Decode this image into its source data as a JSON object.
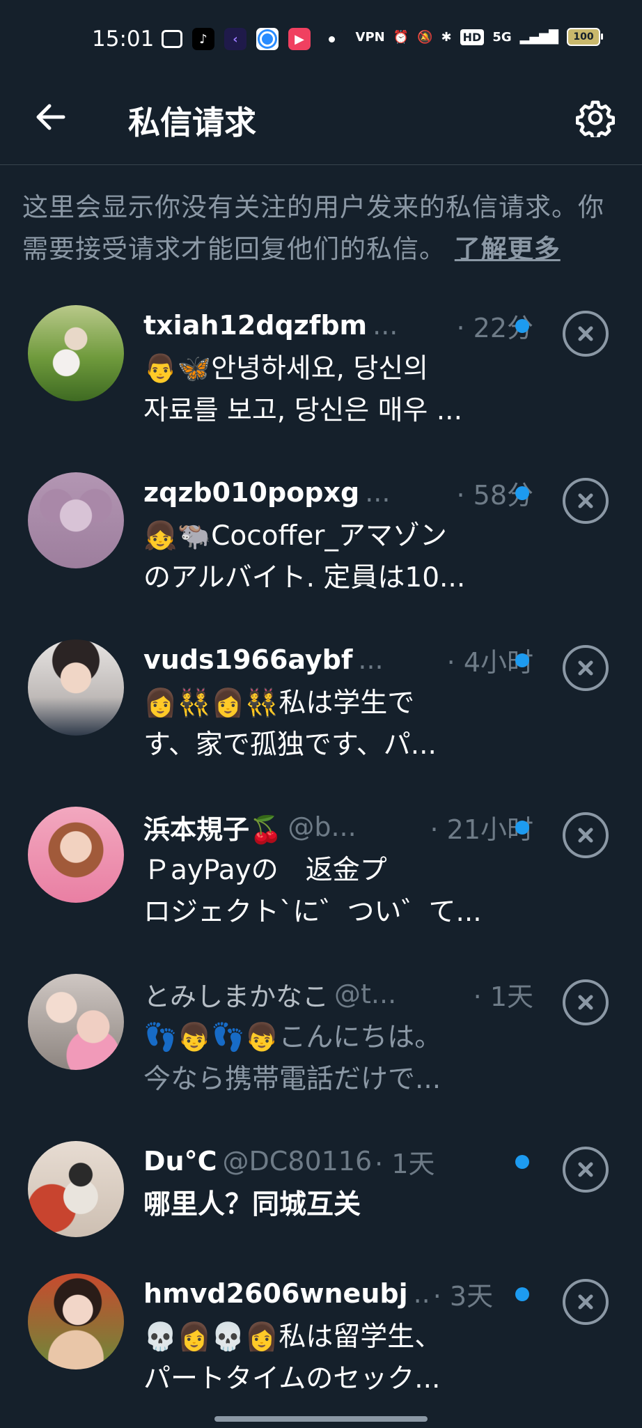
{
  "status_bar": {
    "time": "15:01",
    "network": "5G",
    "battery": "100",
    "vpn_label": "VPN",
    "hd_label": "HD"
  },
  "header": {
    "title": "私信请求",
    "back_icon": "arrow-left-icon",
    "settings_icon": "gear-icon"
  },
  "intro": {
    "text": "这里会显示你没有关注的用户发来的私信请求。你需要接受请求才能回复他们的私信。",
    "link": "了解更多"
  },
  "requests": [
    {
      "name": "txiah12dqzfbm",
      "handle": "...",
      "time": "· 22分",
      "unread": true,
      "line1": "👨🦋안녕하세요, 당신의",
      "line2": "자료를 보고, 당신은 매우 ...",
      "read": false
    },
    {
      "name": "zqzb010popxg",
      "handle": "...",
      "time": "· 58分",
      "unread": true,
      "line1": "👧🐃Cocoffer_アマゾン",
      "line2": "のアルバイト. 定員は10...",
      "read": false
    },
    {
      "name": "vuds1966aybf",
      "handle": "...",
      "time": "· 4小时",
      "unread": true,
      "line1": "👩👯👩👯私は学生で",
      "line2": "す、家で孤独です、パ...",
      "read": false
    },
    {
      "name": "浜本規子🍒",
      "handle": "@b...",
      "time": "· 21小时",
      "unread": true,
      "line1": "ＰayPayの　返金プ",
      "line2": "ロジェクト`に゛つい゛て...",
      "read": false
    },
    {
      "name": "とみしまかなこ",
      "handle": "@t...",
      "time": "· 1天",
      "unread": false,
      "line1": "👣👦👣👦こんにちは。",
      "line2": "今なら携帯電話だけで...",
      "read": true
    },
    {
      "name": "Du°C",
      "handle": "@DC80116",
      "time": "· 1天",
      "unread": true,
      "line1": "哪里人？同城互关",
      "line2": "",
      "read": false
    },
    {
      "name": "hmvd2606wneubj",
      "handle": "..",
      "time": "· 3天",
      "unread": true,
      "line1": "💀👩💀👩私は留学生、",
      "line2": "パートタイムのセック...",
      "read": false
    }
  ],
  "colors": {
    "background": "#15202b",
    "accent": "#1d9bf0",
    "secondary_text": "#8b98a5"
  }
}
